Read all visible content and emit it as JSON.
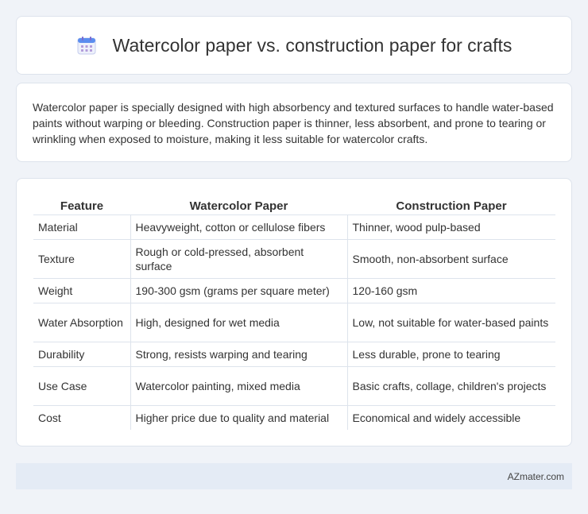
{
  "header": {
    "title": "Watercolor paper vs. construction paper for crafts",
    "icon": "calendar-icon"
  },
  "intro": {
    "text": "Watercolor paper is specially designed with high absorbency and textured surfaces to handle water-based paints without warping or bleeding. Construction paper is thinner, less absorbent, and prone to tearing or wrinkling when exposed to moisture, making it less suitable for watercolor crafts."
  },
  "table": {
    "headers": [
      "Feature",
      "Watercolor Paper",
      "Construction Paper"
    ],
    "rows": [
      [
        "Material",
        "Heavyweight, cotton or cellulose fibers",
        "Thinner, wood pulp-based"
      ],
      [
        "Texture",
        "Rough or cold-pressed, absorbent surface",
        "Smooth, non-absorbent surface"
      ],
      [
        "Weight",
        "190-300 gsm (grams per square meter)",
        "120-160 gsm"
      ],
      [
        "Water Absorption",
        "High, designed for wet media",
        "Low, not suitable for water-based paints"
      ],
      [
        "Durability",
        "Strong, resists warping and tearing",
        "Less durable, prone to tearing"
      ],
      [
        "Use Case",
        "Watercolor painting, mixed media",
        "Basic crafts, collage, children's projects"
      ],
      [
        "Cost",
        "Higher price due to quality and material",
        "Economical and widely accessible"
      ]
    ]
  },
  "footer": {
    "brand": "AZmater.com"
  },
  "colors": {
    "background": "#f0f3f8",
    "card": "#ffffff",
    "border": "#dde3ec",
    "footer_bg": "#e4ebf5",
    "icon_accent": "#8e79d8"
  }
}
